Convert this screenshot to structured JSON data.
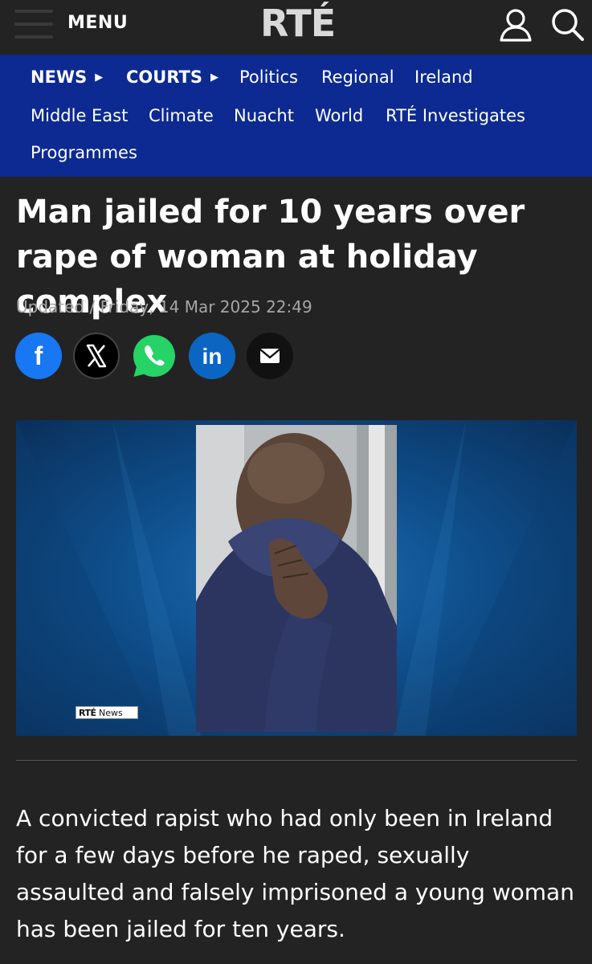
{
  "header": {
    "menu_label": "MENU",
    "logo_text": "RTÉ",
    "user_icon": "user-icon",
    "search_icon": "search-icon"
  },
  "nav": {
    "section": "NEWS",
    "subsection": "COURTS",
    "links": [
      "Politics",
      "Regional",
      "Ireland",
      "Middle East",
      "Climate",
      "Nuacht",
      "World",
      "RTÉ Investigates",
      "Programmes"
    ]
  },
  "article": {
    "headline": "Man jailed for 10 years over rape of woman at holiday complex",
    "updated": "Updated / Friday, 14 Mar 2025 22:49",
    "image_badge_brand": "RTÉ",
    "image_badge_text": "News",
    "lead": "A convicted rapist who had only been in Ireland for a few days before he raped, sexually assaulted and falsely imprisoned a young woman has been jailed for ten years."
  },
  "share": {
    "facebook_glyph": "f",
    "linkedin_glyph": "in",
    "icons": [
      "facebook-icon",
      "x-icon",
      "whatsapp-icon",
      "linkedin-icon",
      "email-icon"
    ]
  },
  "colors": {
    "background": "#232323",
    "nav_background": "#0c2a92",
    "facebook": "#1877f2",
    "whatsapp": "#25d366",
    "linkedin": "#0a66c2",
    "x": "#000000"
  }
}
